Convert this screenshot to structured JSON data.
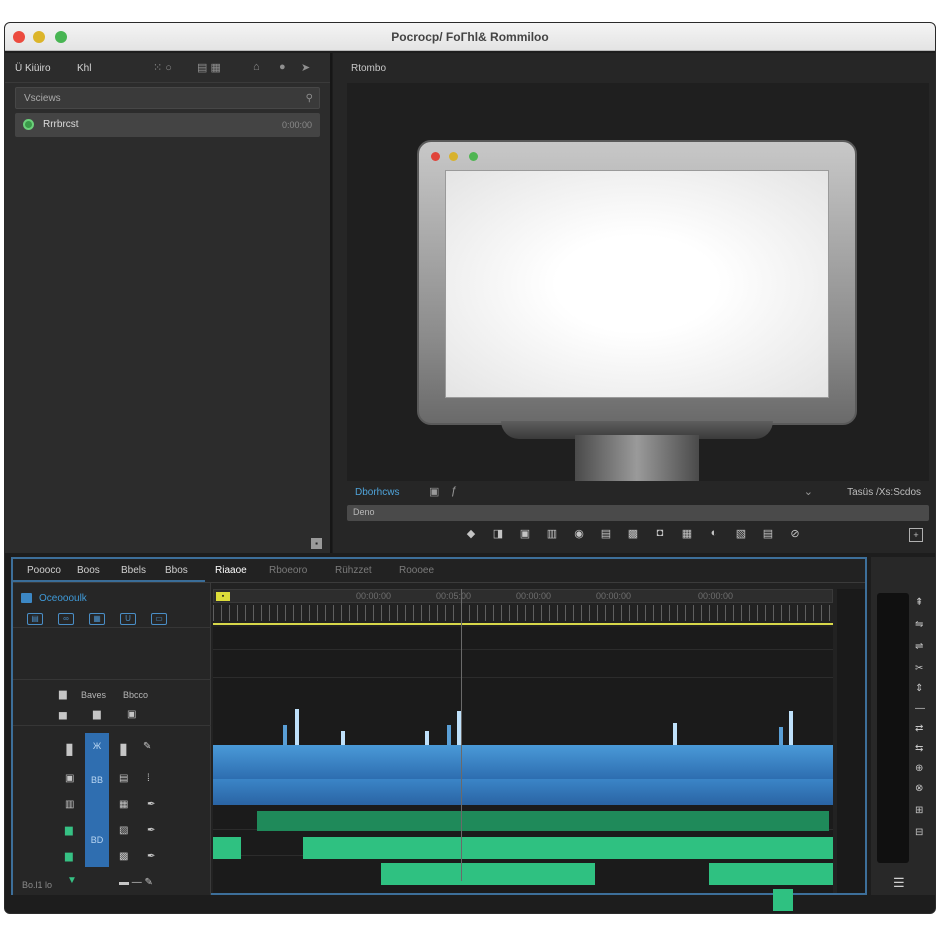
{
  "window": {
    "title": "Рocrocp/ FoГhl& Rommiloo"
  },
  "project_panel": {
    "tab_1": "Ü Kiüiro",
    "tab_2": "Khl",
    "search_placeholder": "Vsciews",
    "item": {
      "name": "Rrrbrcst",
      "duration": "0:00:00"
    }
  },
  "monitor": {
    "title": "Rtombo",
    "label": "Dborhcws",
    "timecode": "Tasüs /Xs:Scdos",
    "scrub_label": "Deno"
  },
  "timeline": {
    "tabs": [
      "Poooco",
      "Boos",
      "Bbels",
      "Bbos",
      "Riaaoe",
      "Rboeoro",
      "Rühzzet",
      "Roooee"
    ],
    "sequence_name": "Oceoooulk",
    "ruler_timecodes": [
      "00:00:00",
      "00:05:00",
      "00:00:00",
      "00:00:00",
      "00:00:00"
    ],
    "header_labels": {
      "a": "Baves",
      "b": "Bbcco"
    },
    "column_labels": [
      "Ж",
      "BB",
      "BD"
    ]
  },
  "status_bar": {
    "text": "Bo.l1 lo"
  },
  "colors": {
    "accent": "#3f9ad8",
    "clip_blue": "#2d6db0",
    "clip_green": "#2fc181",
    "playhead_bar": "#d8d84a"
  }
}
